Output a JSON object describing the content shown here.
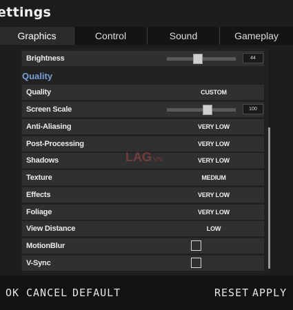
{
  "window": {
    "title": "ettings"
  },
  "tabs": [
    {
      "label": "Graphics",
      "active": true
    },
    {
      "label": "Control"
    },
    {
      "label": "Sound"
    },
    {
      "label": "Gameplay"
    }
  ],
  "brightness": {
    "label": "Brightness",
    "value": "44",
    "fraction": 0.44
  },
  "quality_section": {
    "heading": "Quality"
  },
  "settings": {
    "quality": {
      "label": "Quality",
      "value": "CUSTOM"
    },
    "screen_scale": {
      "label": "Screen Scale",
      "value": "100",
      "fraction": 0.6
    },
    "anti_aliasing": {
      "label": "Anti-Aliasing",
      "value": "VERY LOW"
    },
    "post_processing": {
      "label": "Post-Processing",
      "value": "VERY LOW"
    },
    "shadows": {
      "label": "Shadows",
      "value": "VERY LOW"
    },
    "texture": {
      "label": "Texture",
      "value": "MEDIUM"
    },
    "effects": {
      "label": "Effects",
      "value": "VERY LOW"
    },
    "foliage": {
      "label": "Foliage",
      "value": "VERY LOW"
    },
    "view_distance": {
      "label": "View Distance",
      "value": "LOW"
    },
    "motion_blur": {
      "label": "MotionBlur",
      "checked": false
    },
    "vsync": {
      "label": "V-Sync",
      "checked": false
    }
  },
  "watermark": {
    "text": "LAG.VN"
  },
  "footer": {
    "ok": "OK",
    "cancel": "CANCEL",
    "default": "DEFAULT",
    "reset": "RESET",
    "apply": "APPLY"
  },
  "colors": {
    "accent": "#7b9fd6",
    "row": "#303030",
    "background": "#1d1d1d"
  }
}
